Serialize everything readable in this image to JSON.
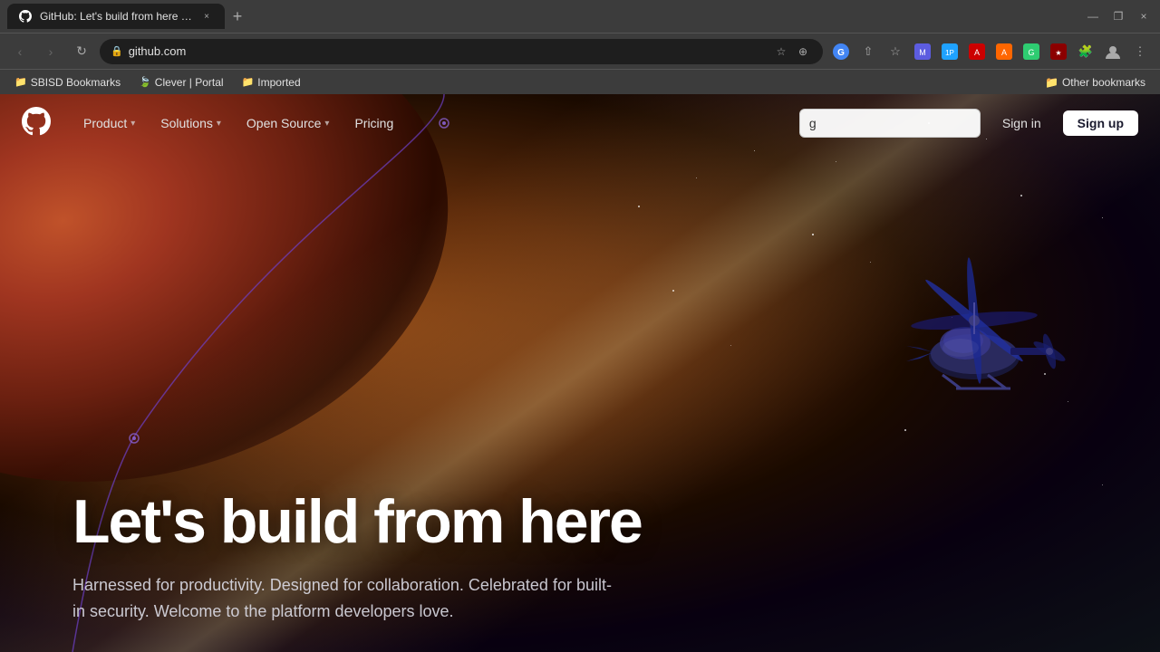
{
  "browser": {
    "tab": {
      "favicon": "⬤",
      "title": "GitHub: Let's build from here · G",
      "close_label": "×"
    },
    "new_tab_label": "+",
    "window_controls": {
      "minimize": "—",
      "maximize": "❐",
      "close": "×"
    },
    "nav": {
      "back_label": "‹",
      "forward_label": "›",
      "reload_label": "↻",
      "address": "github.com",
      "lock_icon": "🔒"
    },
    "toolbar_icons": [
      "⊕",
      "⋮"
    ],
    "bookmarks": [
      {
        "icon": "📁",
        "label": "SBISD Bookmarks"
      },
      {
        "icon": "🍃",
        "label": "Clever | Portal"
      },
      {
        "icon": "📁",
        "label": "Imported"
      }
    ],
    "other_bookmarks_label": "Other bookmarks"
  },
  "github": {
    "logo_title": "GitHub",
    "nav_items": [
      {
        "label": "Product",
        "has_dropdown": true
      },
      {
        "label": "Solutions",
        "has_dropdown": true
      },
      {
        "label": "Open Source",
        "has_dropdown": true
      },
      {
        "label": "Pricing",
        "has_dropdown": false
      }
    ],
    "search": {
      "value": "g",
      "placeholder": ""
    },
    "signin_label": "Sign in",
    "signup_label": "Sign up",
    "hero_title": "Let's build from here",
    "hero_subtitle": "Harnessed for productivity. Designed for collaboration. Celebrated for built-in security. Welcome to the platform developers love."
  },
  "colors": {
    "accent_purple": "#6e40c9",
    "github_dark": "#0d1117",
    "tab_active": "#1e1e1e",
    "chrome_bg": "#3c3c3c"
  }
}
